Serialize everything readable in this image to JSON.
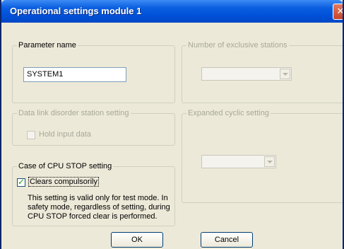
{
  "window": {
    "title": "Operational settings  module 1",
    "close_glyph": "✕"
  },
  "parameter_name": {
    "legend": "Parameter name",
    "value": "SYSTEM1"
  },
  "exclusive_stations": {
    "legend": "Number of exclusive stations",
    "selected": ""
  },
  "data_link_disorder": {
    "legend": "Data link disorder station setting",
    "hold_input_label": "Hold input data",
    "hold_input_checked": false
  },
  "expanded_cyclic": {
    "legend": "Expanded cyclic setting",
    "selected": ""
  },
  "cpu_stop": {
    "legend": "Case of CPU STOP setting",
    "clears_label": "Clears compulsorily",
    "clears_checked": true,
    "check_glyph": "✓",
    "note_line1": "This setting is valid only for test mode. In",
    "note_line2": "safety mode, regardless of setting, during",
    "note_line3": "CPU STOP forced clear is performed."
  },
  "buttons": {
    "ok": "OK",
    "cancel": "Cancel"
  },
  "colors": {
    "titlebar": "#0050d8",
    "dialog_bg": "#ece9d8",
    "close_button": "#c6452a",
    "check": "#21a121"
  }
}
